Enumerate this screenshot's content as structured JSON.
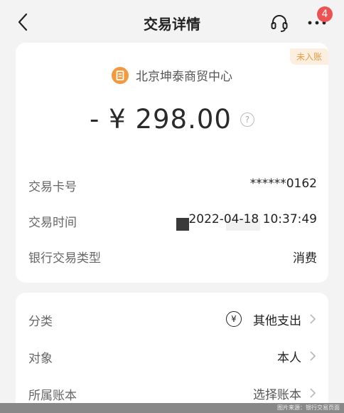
{
  "header": {
    "title": "交易详情",
    "badge_count": "4"
  },
  "status_tag": "未入账",
  "merchant": {
    "icon": "receipt-icon",
    "name": "北京坤泰商贸中心"
  },
  "amount": {
    "text": "- ¥ 298.00"
  },
  "details": [
    {
      "label": "交易卡号",
      "value": "******0162"
    },
    {
      "label": "交易时间",
      "value": "2022-04-18 10:37:49"
    },
    {
      "label": "银行交易类型",
      "value": "消费"
    }
  ],
  "actions": [
    {
      "label": "分类",
      "value": "其他支出",
      "icon": "yen-icon"
    },
    {
      "label": "对象",
      "value": "本人"
    },
    {
      "label": "所属账本",
      "value": "选择账本"
    }
  ],
  "footer": {
    "caption": "图片来源：银行交易页面"
  },
  "colors": {
    "accent_orange": "#f29a3d",
    "tag_text": "#e79a47",
    "badge_red": "#ee5151"
  }
}
